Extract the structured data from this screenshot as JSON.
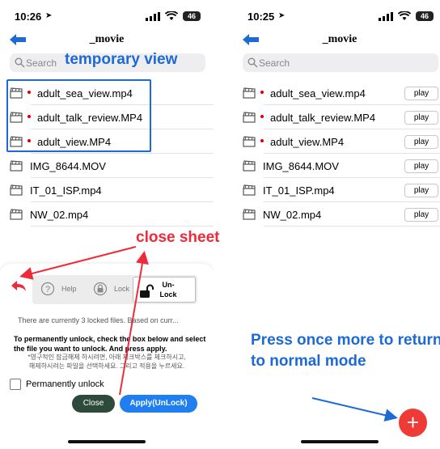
{
  "left": {
    "status": {
      "time": "10:26",
      "battery": "46"
    },
    "nav_title": "_movie",
    "search_placeholder": "Search",
    "files": [
      {
        "name": "adult_sea_view.mp4",
        "locked": true
      },
      {
        "name": "adult_talk_review.MP4",
        "locked": true
      },
      {
        "name": "adult_view.MP4",
        "locked": true
      },
      {
        "name": "IMG_8644.MOV",
        "locked": false
      },
      {
        "name": "IT_01_ISP.mp4",
        "locked": false
      },
      {
        "name": "NW_02.mp4",
        "locked": false
      }
    ],
    "sheet": {
      "toolbar": {
        "help": "Help",
        "lock": "Lock",
        "unlock_line1": "Un-",
        "unlock_line2": "Lock"
      },
      "info": "There are currently 3 locked files. Based on curr...",
      "instruction": "To permanently unlock, check the box below and select the file you want to unlock. And press apply.",
      "korean_line1": "*영구적인 잠금해제 하시려면, 아래 체크박스를 체크하시고,",
      "korean_line2": "해제하시려는 파일을 선택하세요. 그리고 적용을 누르세요.",
      "checkbox_label": "Permanently unlock",
      "close_button": "Close",
      "apply_button": "Apply(UnLock)"
    }
  },
  "right": {
    "status": {
      "time": "10:25",
      "battery": "46"
    },
    "nav_title": "_movie",
    "search_placeholder": "Search",
    "play_label": "play",
    "files": [
      {
        "name": "adult_sea_view.mp4",
        "locked": true
      },
      {
        "name": "adult_talk_review.MP4",
        "locked": true
      },
      {
        "name": "adult_view.MP4",
        "locked": true
      },
      {
        "name": "IMG_8644.MOV",
        "locked": false
      },
      {
        "name": "IT_01_ISP.mp4",
        "locked": false
      },
      {
        "name": "NW_02.mp4",
        "locked": false
      }
    ],
    "fab_label": "+"
  },
  "annotations": {
    "temporary_view": "temporary view",
    "close_sheet": "close  sheet",
    "press_once": "Press once more to return to normal mode"
  },
  "colors": {
    "annotation_blue": "#1d6ad6",
    "annotation_red": "#ef2a3a",
    "apply_blue": "#1f7ef0",
    "close_green": "#2e4a3a",
    "fab_red": "#ef3b36"
  }
}
